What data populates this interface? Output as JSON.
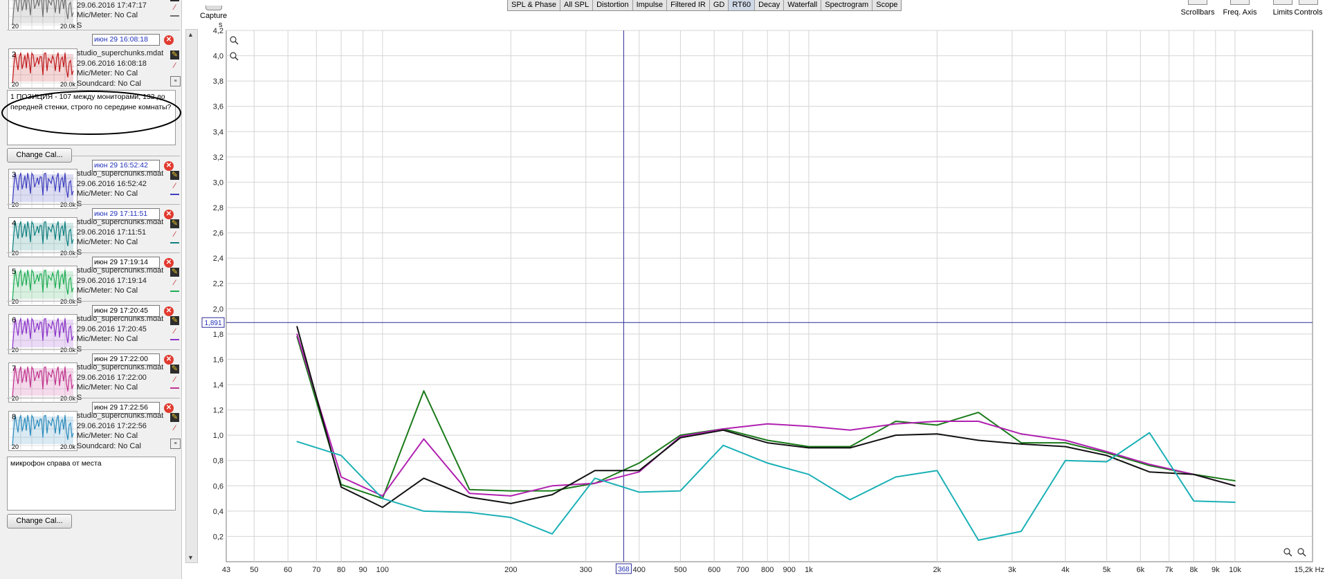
{
  "toolbar": {
    "capture": "Capture",
    "right_tools": [
      "Scrollbars",
      "Freq. Axis",
      "Limits",
      "Controls"
    ]
  },
  "tabs": [
    "SPL & Phase",
    "All SPL",
    "Distortion",
    "Impulse",
    "Filtered IR",
    "GD",
    "RT60",
    "Decay",
    "Waterfall",
    "Spectrogram",
    "Scope"
  ],
  "selected_tab": "RT60",
  "measurements": [
    {
      "num": "1",
      "file": "studio_superchunks.mdat",
      "date": "29.06.2016 17:47:17",
      "mic": "Mic/Meter: No Cal",
      "sound": "S",
      "tag": "",
      "color": "#6f6f6f",
      "thumb_left": "20",
      "thumb_right": "20.0k"
    },
    {
      "num": "2",
      "file": "studio_superchunks.mdat",
      "date": "29.06.2016 16:08:18",
      "mic": "Mic/Meter: No Cal",
      "sound": "Soundcard: No Cal",
      "tag": "июн 29 16:08:18",
      "color": "#c0191c",
      "thumb_left": "20",
      "thumb_right": "20.0k"
    },
    {
      "num": "3",
      "file": "studio_superchunks.mdat",
      "date": "29.06.2016 16:52:42",
      "mic": "Mic/Meter: No Cal",
      "sound": "S",
      "tag": "июн 29 16:52:42",
      "color": "#3d3fbf",
      "thumb_left": "20",
      "thumb_right": "20.0k"
    },
    {
      "num": "4",
      "file": "studio_superchunks.mdat",
      "date": "29.06.2016 17:11:51",
      "mic": "Mic/Meter: No Cal",
      "sound": "S",
      "tag": "июн 29 17:11:51",
      "color": "#0f7f7f",
      "thumb_left": "20",
      "thumb_right": "20.0k"
    },
    {
      "num": "5",
      "file": "studio_superchunks.mdat",
      "date": "29.06.2016 17:19:14",
      "mic": "Mic/Meter: No Cal",
      "sound": "S",
      "tag": "июн 29 17:19:14",
      "color": "#1fae55",
      "thumb_left": "20",
      "thumb_right": "20.0k"
    },
    {
      "num": "6",
      "file": "studio_superchunks.mdat",
      "date": "29.06.2016 17:20:45",
      "mic": "Mic/Meter: No Cal",
      "sound": "S",
      "tag": "июн 29 17:20:45",
      "color": "#8b33c8",
      "thumb_left": "20",
      "thumb_right": "20.0k"
    },
    {
      "num": "7",
      "file": "studio_superchunks.mdat",
      "date": "29.06.2016 17:22:00",
      "mic": "Mic/Meter: No Cal",
      "sound": "S",
      "tag": "июн 29 17:22:00",
      "color": "#c2328f",
      "thumb_left": "20",
      "thumb_right": "20.0k"
    },
    {
      "num": "8",
      "file": "studio_superchunks.mdat",
      "date": "29.06.2016 17:22:56",
      "mic": "Mic/Meter: No Cal",
      "sound": "Soundcard: No Cal",
      "tag": "июн 29 17:22:56",
      "color": "#2b8bbd",
      "thumb_left": "20",
      "thumb_right": "20.0k"
    }
  ],
  "notes": {
    "note2": "1 ПОЗИЦИЯ - 107 между мониторами, 132 до передней стенки, строго по середине комнаты?",
    "note8": "микрофон справа от места"
  },
  "change_cal": "Change Cal...",
  "chart_data": {
    "type": "line",
    "ylabel": "s",
    "xlabel": "Hz",
    "x_scale": "log",
    "xlim": [
      43,
      15200
    ],
    "ylim": [
      0,
      4.2
    ],
    "grid": true,
    "x_ticks": [
      "43",
      "50",
      "60",
      "70",
      "80",
      "90",
      "100",
      "200",
      "300",
      "400",
      "500",
      "600",
      "700",
      "800",
      "900",
      "1k",
      "2k",
      "3k",
      "4k",
      "5k",
      "6k",
      "7k",
      "8k",
      "9k",
      "10k",
      "15,2k Hz"
    ],
    "y_ticks": [
      "0,2",
      "0,4",
      "0,6",
      "0,8",
      "1,0",
      "1,2",
      "1,4",
      "1,6",
      "1,8",
      "2,0",
      "2,2",
      "2,4",
      "2,6",
      "2,8",
      "3,0",
      "3,2",
      "3,4",
      "3,6",
      "3,8",
      "4,0",
      "4,2"
    ],
    "cursor": {
      "x": 368,
      "x_label": "368",
      "y": 1.891,
      "y_label": "1,891"
    },
    "x": [
      63,
      80,
      100,
      125,
      160,
      200,
      250,
      315,
      400,
      500,
      630,
      800,
      1000,
      1250,
      1600,
      2000,
      2500,
      3150,
      4000,
      5000,
      6300,
      8000,
      10000
    ],
    "series": [
      {
        "color": "#1a7a1a",
        "values": [
          1.78,
          0.61,
          0.5,
          1.35,
          0.57,
          0.56,
          0.56,
          0.62,
          0.78,
          1.0,
          1.05,
          0.96,
          0.91,
          0.91,
          1.11,
          1.08,
          1.18,
          0.94,
          0.94,
          0.86,
          0.76,
          0.69,
          0.64
        ]
      },
      {
        "color": "#b020b0",
        "values": [
          1.8,
          0.67,
          0.52,
          0.97,
          0.54,
          0.52,
          0.6,
          0.62,
          0.71,
          0.99,
          1.05,
          1.09,
          1.07,
          1.04,
          1.09,
          1.11,
          1.11,
          1.01,
          0.96,
          0.87,
          0.77,
          0.69,
          0.6
        ]
      },
      {
        "color": "#111111",
        "values": [
          1.86,
          0.59,
          0.43,
          0.66,
          0.51,
          0.46,
          0.53,
          0.72,
          0.72,
          0.98,
          1.04,
          0.94,
          0.9,
          0.9,
          1.0,
          1.01,
          0.96,
          0.93,
          0.91,
          0.84,
          0.71,
          0.69,
          0.6
        ]
      },
      {
        "color": "#1ab0b6",
        "values": [
          0.95,
          0.84,
          0.5,
          0.4,
          0.39,
          0.35,
          0.22,
          0.66,
          0.55,
          0.56,
          0.92,
          0.78,
          0.69,
          0.49,
          0.67,
          0.72,
          0.17,
          0.24,
          0.8,
          0.79,
          1.02,
          0.48,
          0.47
        ]
      }
    ]
  }
}
